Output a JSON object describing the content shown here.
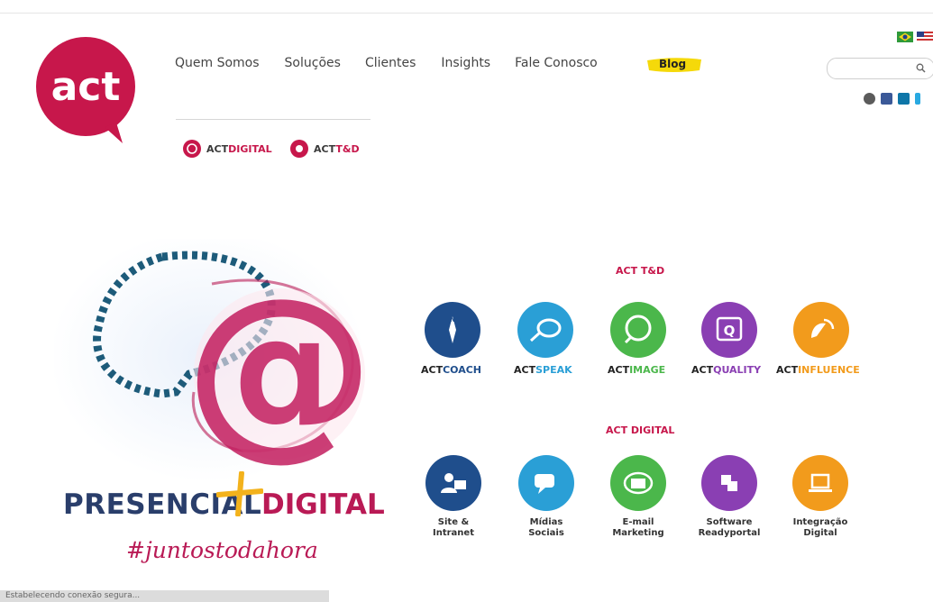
{
  "brand": {
    "logo_text": "act",
    "accent": "#c7174b"
  },
  "nav": {
    "items": [
      "Quem Somos",
      "Soluções",
      "Clientes",
      "Insights",
      "Fale Conosco"
    ],
    "blog": "Blog"
  },
  "subnav": {
    "a_prefix": "ACT",
    "a_suffix": "DIGITAL",
    "b_prefix": "ACT",
    "b_suffix": "T&D"
  },
  "hero": {
    "left_text": "PRESENCIAL",
    "right_text": "DIGITAL",
    "hashtag": "#juntostodahora"
  },
  "sections": {
    "td": {
      "title": "ACT T&D",
      "items": [
        {
          "prefix": "ACT",
          "suffix": "COACH",
          "color": "#1f4e8c",
          "icon": "compass-icon"
        },
        {
          "prefix": "ACT",
          "suffix": "SPEAK",
          "color": "#2a9fd6",
          "icon": "speech-icon"
        },
        {
          "prefix": "ACT",
          "suffix": "IMAGE",
          "color": "#4bb74b",
          "icon": "magnifier-icon"
        },
        {
          "prefix": "ACT",
          "suffix": "QUALITY",
          "color": "#8a3fb3",
          "icon": "quality-icon"
        },
        {
          "prefix": "ACT",
          "suffix": "INFLUENCE",
          "color": "#f29b1c",
          "icon": "satellite-icon"
        }
      ]
    },
    "digital": {
      "title": "ACT DIGITAL",
      "items": [
        {
          "label1": "Site &",
          "label2": "Intranet",
          "color": "#1f4e8c",
          "icon": "people-icon"
        },
        {
          "label1": "Mídias",
          "label2": "Sociais",
          "color": "#2a9fd6",
          "icon": "chat-icon"
        },
        {
          "label1": "E-mail",
          "label2": "Marketing",
          "color": "#4bb74b",
          "icon": "mail-icon"
        },
        {
          "label1": "Software",
          "label2": "Readyportal",
          "color": "#8a3fb3",
          "icon": "portal-icon"
        },
        {
          "label1": "Integração",
          "label2": "Digital",
          "color": "#f29b1c",
          "icon": "laptop-icon"
        }
      ]
    }
  },
  "status_bar": {
    "text": "Estabelecendo conexão segura..."
  }
}
